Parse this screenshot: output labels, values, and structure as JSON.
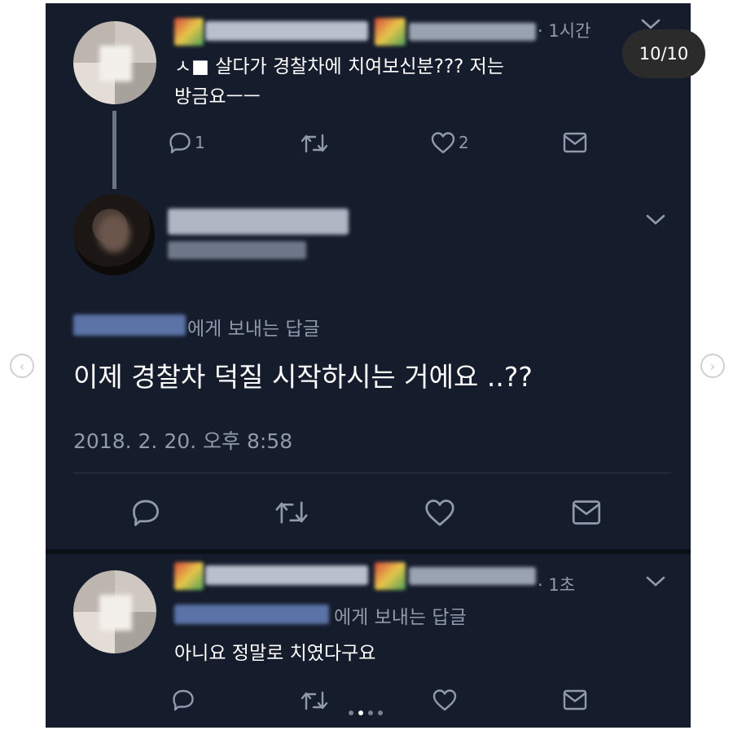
{
  "carousel": {
    "counter": "10/10",
    "prev_icon": "chevron-left-icon",
    "next_icon": "chevron-right-icon",
    "dot_count": 4,
    "active_dot": 1
  },
  "colors": {
    "background": "#151c2c",
    "text": "#ffffff",
    "muted": "#8f9aab"
  },
  "tweet1": {
    "time": "· 1시간",
    "text_line1": "ㅅ■ 살다가 경찰차에 치여보신분??? 저는",
    "text_line2": "방금요ㅡㅡ",
    "reply_count": "1",
    "like_count": "2",
    "menu_icon": "chevron-down-icon"
  },
  "tweet2": {
    "reply_to": "에게 보내는 답글",
    "text": "이제 경찰차 덕질 시작하시는 거에요 ..??",
    "date": "2018. 2. 20. 오후 8:58",
    "menu_icon": "chevron-down-icon"
  },
  "tweet3": {
    "time": "· 1초",
    "reply_to": "에게 보내는 답글",
    "text": "아니요 정말로 치였다구요",
    "menu_icon": "chevron-down-icon"
  },
  "action_icons": [
    "reply-icon",
    "retweet-icon",
    "like-icon",
    "dm-icon"
  ]
}
